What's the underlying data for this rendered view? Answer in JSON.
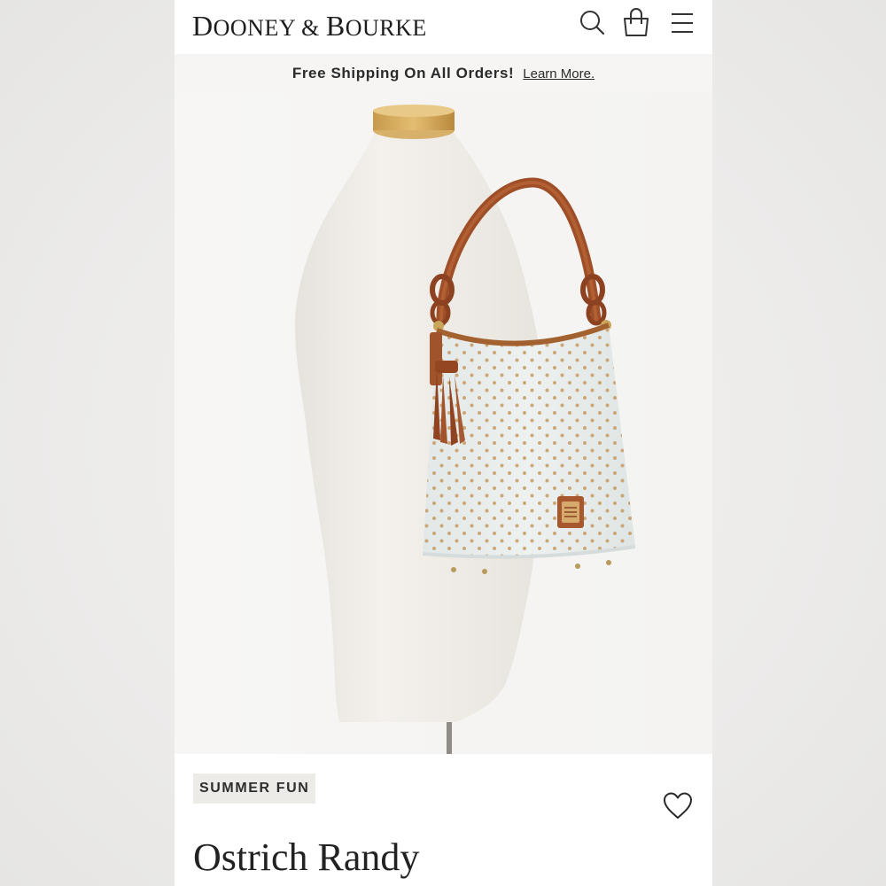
{
  "header": {
    "brand": {
      "d": "D",
      "ooney": "OONEY",
      "amp": " & ",
      "b": "B",
      "ourke": "OURKE"
    },
    "icons": [
      "search-icon",
      "shopping-bag-icon",
      "menu-icon"
    ]
  },
  "promo": {
    "text": "Free Shipping On All Orders!",
    "link": "Learn More."
  },
  "gallery": {
    "image_alt": "Ostrich Randy bag on a mannequin",
    "slide_count": 5,
    "active_slide": 5
  },
  "product": {
    "badge": "SUMMER FUN",
    "name": "Ostrich Randy"
  },
  "colors": {
    "accent": "#a5532b",
    "bag_body": "#e6ebea",
    "text": "#222222"
  }
}
